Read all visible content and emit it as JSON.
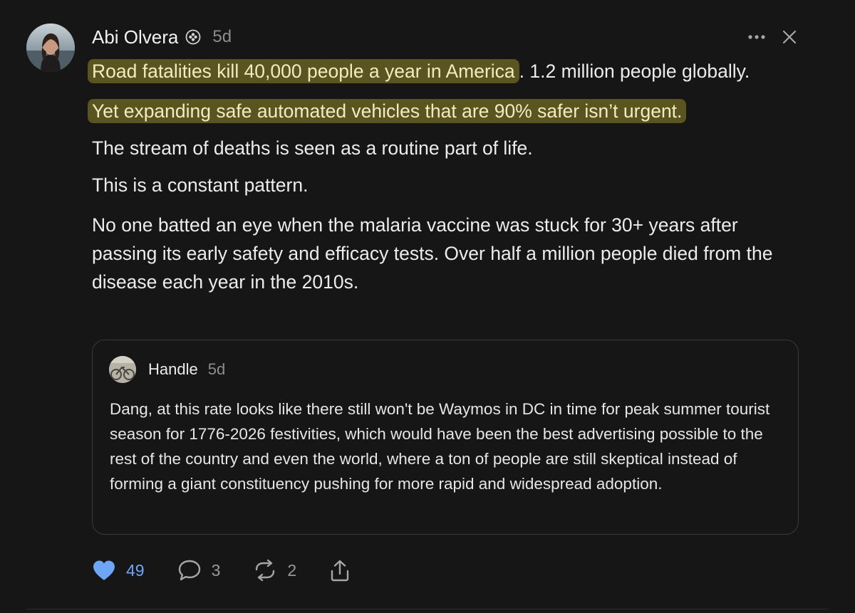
{
  "post": {
    "author": "Abi Olvera",
    "time": "5d",
    "badge_icon": "verified-badge-icon",
    "highlight_color": "#5a5420",
    "paragraphs": {
      "p1_highlight": "Road fatalities kill 40,000 people a year in America",
      "p1_rest": ". 1.2 million people globally.",
      "p2_highlight": "Yet expanding safe automated vehicles that are 90% safer isn’t urgent.",
      "p3": "The stream of deaths is seen as a routine part of life.",
      "p4": "This is a constant pattern.",
      "p5": "No one batted an eye when the malaria vaccine was stuck for 30+ years after passing its early safety and efficacy tests. Over half a million people died from the disease each year in the 2010s."
    }
  },
  "quote": {
    "author": "Handle",
    "time": "5d",
    "text": "Dang, at this rate looks like there still won't be Waymos in DC in time for peak summer tourist season for 1776-2026 festivities, which would have been the best advertising possible to the rest of the country and even the world, where a ton of people are still skeptical instead of forming a giant constituency pushing for more rapid and widespread adoption."
  },
  "actions": {
    "likes": "49",
    "comments": "3",
    "reposts": "2",
    "like_color": "#6ea5f5"
  },
  "icons": {
    "more": "more-options-icon",
    "close": "close-icon",
    "like": "heart-icon",
    "comment": "comment-icon",
    "repost": "repost-icon",
    "share": "share-icon"
  }
}
